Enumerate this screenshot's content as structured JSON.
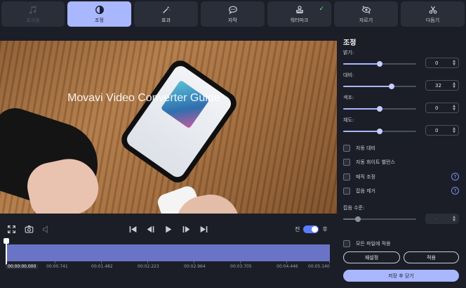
{
  "tabs": [
    {
      "label": "효과음",
      "icon": "music-note-icon",
      "state": "disabled"
    },
    {
      "label": "조정",
      "icon": "contrast-icon",
      "state": "active"
    },
    {
      "label": "효과",
      "icon": "magic-wand-icon",
      "state": "normal"
    },
    {
      "label": "자막",
      "icon": "speech-bubble-icon",
      "state": "normal"
    },
    {
      "label": "워터마크",
      "icon": "stamp-icon",
      "state": "normal",
      "check": "✓"
    },
    {
      "label": "자르기",
      "icon": "crop-eye-icon",
      "state": "normal"
    },
    {
      "label": "다듬기",
      "icon": "scissors-icon",
      "state": "normal"
    }
  ],
  "video": {
    "watermark_text": "Movavi Video Converter Guide"
  },
  "player": {
    "toggle_before": "전",
    "toggle_after": "후",
    "toggle_on": true
  },
  "timeline": {
    "current_time": "00:00:00.000",
    "ticks": [
      "00:00.741",
      "00:01.482",
      "00:02.223",
      "00:02.964",
      "00:03.705",
      "00:04.446",
      "00:05.140"
    ]
  },
  "panel": {
    "title": "조정",
    "sliders": [
      {
        "label": "밝기:",
        "value": "0",
        "level": 0.5
      },
      {
        "label": "대비:",
        "value": "32",
        "level": 0.66
      },
      {
        "label": "색조:",
        "value": "0",
        "level": 0.5
      },
      {
        "label": "채도:",
        "value": "0",
        "level": 0.5
      }
    ],
    "checkboxes": [
      {
        "label": "자동 대비",
        "checked": false,
        "help": false
      },
      {
        "label": "자동 화이트 밸런스",
        "checked": false,
        "help": false
      },
      {
        "label": "매직 조정",
        "checked": false,
        "help": true
      },
      {
        "label": "잡음 제거",
        "checked": false,
        "help": true
      }
    ],
    "noise_level": {
      "label": "잡음 수준:",
      "value": "-",
      "level": 0.2
    },
    "apply_all_label": "모든 파일에 적용",
    "reset_label": "재설정",
    "apply_label": "적용",
    "save_close_label": "저장 후 닫기",
    "help_glyph": "?"
  },
  "colors": {
    "accent": "#a9b7ff",
    "background": "#1b1e26",
    "tab_bg": "#2a2e38",
    "timeline": "#6a74c6",
    "check": "#7de08a"
  }
}
